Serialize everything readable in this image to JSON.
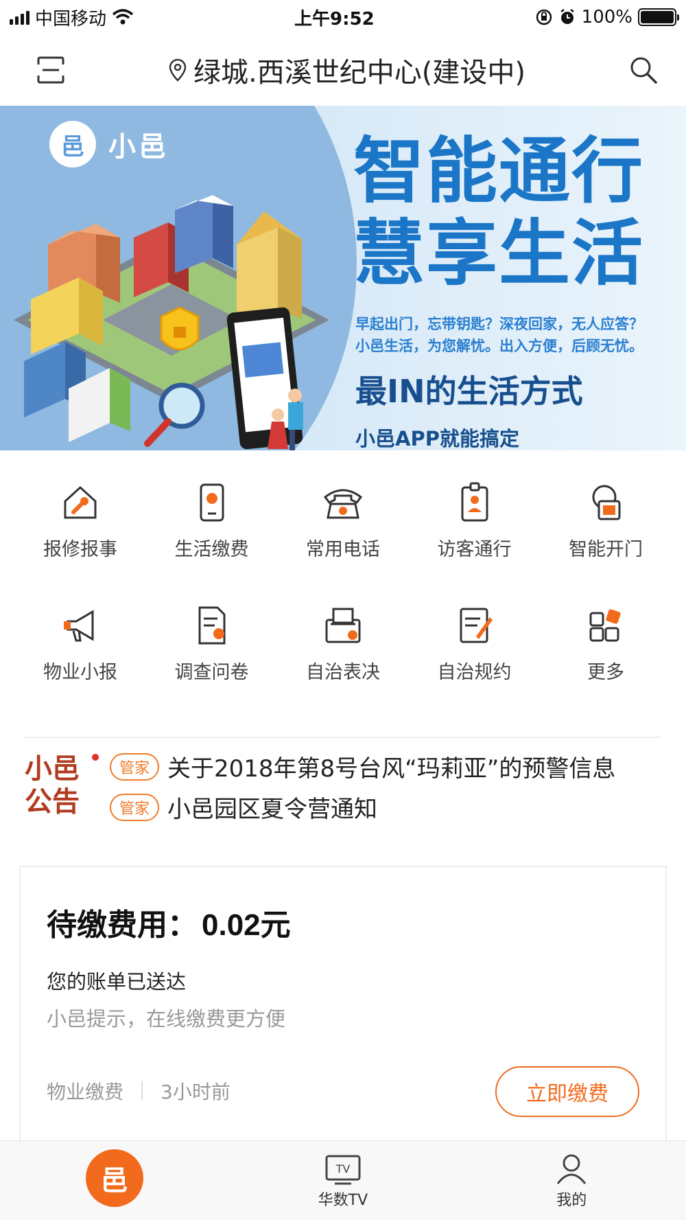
{
  "status_bar": {
    "carrier": "中国移动",
    "time": "上午9:52",
    "battery": "100%",
    "battery_level": 1.0
  },
  "nav": {
    "location": "绿城.西溪世纪中心(建设中)",
    "icons": [
      "scan-icon",
      "location-pin-icon",
      "search-icon"
    ]
  },
  "banner": {
    "brand": "小邑",
    "headline_1": "智能通行",
    "headline_2": "慧享生活",
    "desc_1": "早起出门，忘带钥匙？深夜回家，无人应答？",
    "desc_2": "小邑生活，为您解忧。出入方便，后顾无忧。",
    "slogan": "最IN的生活方式",
    "sub": "小邑APP就能搞定"
  },
  "services": [
    {
      "label": "报修报事",
      "icon": "repair-house-icon"
    },
    {
      "label": "生活缴费",
      "icon": "phone-payment-icon"
    },
    {
      "label": "常用电话",
      "icon": "telephone-icon"
    },
    {
      "label": "访客通行",
      "icon": "visitor-badge-icon"
    },
    {
      "label": "智能开门",
      "icon": "smart-door-icon"
    },
    {
      "label": "物业小报",
      "icon": "megaphone-icon"
    },
    {
      "label": "调查问卷",
      "icon": "survey-icon"
    },
    {
      "label": "自治表决",
      "icon": "vote-box-icon"
    },
    {
      "label": "自治规约",
      "icon": "rules-document-icon"
    },
    {
      "label": "更多",
      "icon": "more-grid-icon"
    }
  ],
  "notice": {
    "logo_line_1": "小邑",
    "logo_line_2": "公告",
    "items": [
      {
        "tag": "管家",
        "text": "关于2018年第8号台风“玛莉亚”的预警信息"
      },
      {
        "tag": "管家",
        "text": "小邑园区夏令营通知"
      }
    ]
  },
  "bill": {
    "amount_label": "待缴费用：",
    "amount": "0.02元",
    "sent": "您的账单已送达",
    "tip": "小邑提示，在线缴费更方便",
    "category": "物业缴费",
    "time": "3小时前",
    "pay_button": "立即缴费"
  },
  "tabs": [
    {
      "label": "",
      "icon": "home-logo-icon"
    },
    {
      "label": "华数TV",
      "icon": "tv-icon"
    },
    {
      "label": "我的",
      "icon": "profile-icon"
    }
  ],
  "colors": {
    "accent": "#f26b1d",
    "banner_blue": "#1b76c8",
    "notice_red": "#b13b1e"
  }
}
